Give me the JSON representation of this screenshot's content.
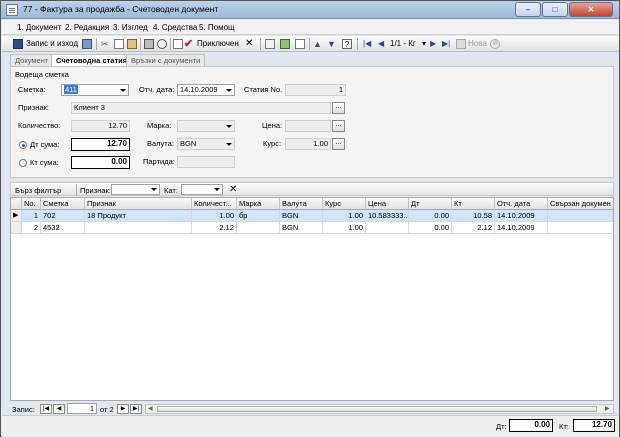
{
  "window": {
    "title": "77 - Фактура за продажба - Счетоводен документ",
    "min_label": "–",
    "max_label": "□",
    "close_label": "✕"
  },
  "menu": [
    {
      "label": "1. Документ"
    },
    {
      "label": "2. Редакция"
    },
    {
      "label": "3. Изглед"
    },
    {
      "label": "4. Средства"
    },
    {
      "label": "5. Помощ"
    }
  ],
  "toolbar": {
    "save_exit_label": "Запис и изход",
    "posted_label": "Приключен",
    "page_label": "1/1 - Кг",
    "new_label": "Нова",
    "close_x": "✕"
  },
  "tabs": [
    {
      "label": "Документ"
    },
    {
      "label": "Счетоводна статия"
    },
    {
      "label": "Връзки с документи"
    }
  ],
  "form": {
    "group_title": "Водеща сметка",
    "account_label": "Сметка:",
    "account_value": "411",
    "date_label": "Отч. дата:",
    "date_value": "14.10.2009",
    "entry_no_label": "Статия No.",
    "entry_no_value": "1",
    "attribute_label": "Признак:",
    "attribute_value": "Клиент 3",
    "quantity_label": "Количество:",
    "quantity_value": "12.70",
    "brand_label": "Марка:",
    "brand_value": "",
    "price_label": "Цена:",
    "price_value": "",
    "debit_label": "Дт сума:",
    "debit_value": "12.70",
    "currency_label": "Валута:",
    "currency_value": "BGN",
    "rate_label": "Курс:",
    "rate_value": "1.00",
    "credit_label": "Кт сума:",
    "credit_value": "0.00",
    "batch_label": "Партида:",
    "batch_value": "",
    "ellipsis": "..."
  },
  "filter": {
    "quick_filter_label": "Бърз филтър",
    "attribute_label": "Признак:",
    "category_label": "Кат:",
    "clear_icon": "✕"
  },
  "grid": {
    "columns": [
      "No.",
      "Сметка",
      "Признак",
      "Количест...",
      "Марка",
      "Валута",
      "Курс",
      "Цена",
      "Дт",
      "Кт",
      "Отч. дата",
      "Свързан докумен"
    ],
    "rows": [
      {
        "no": "1",
        "account": "702",
        "attribute": "18 Продукт",
        "qty": "1.00",
        "brand": "бр",
        "currency": "BGN",
        "rate": "1.00",
        "price": "10.583333...",
        "debit": "0.00",
        "credit": "10.58",
        "date": "14.10.2009",
        "doc": ""
      },
      {
        "no": "2",
        "account": "4532",
        "attribute": "",
        "qty": "2.12",
        "brand": "",
        "currency": "BGN",
        "rate": "1.00",
        "price": "",
        "debit": "0.00",
        "credit": "2.12",
        "date": "14.10.2009",
        "doc": ""
      }
    ],
    "current_row_marker": "▶"
  },
  "status": {
    "record_label": "Запис:",
    "record_value": "1",
    "of_label": "от 2"
  },
  "totals": {
    "debit_label": "Дт:",
    "debit_value": "0.00",
    "credit_label": "Кт:",
    "credit_value": "12.70"
  }
}
